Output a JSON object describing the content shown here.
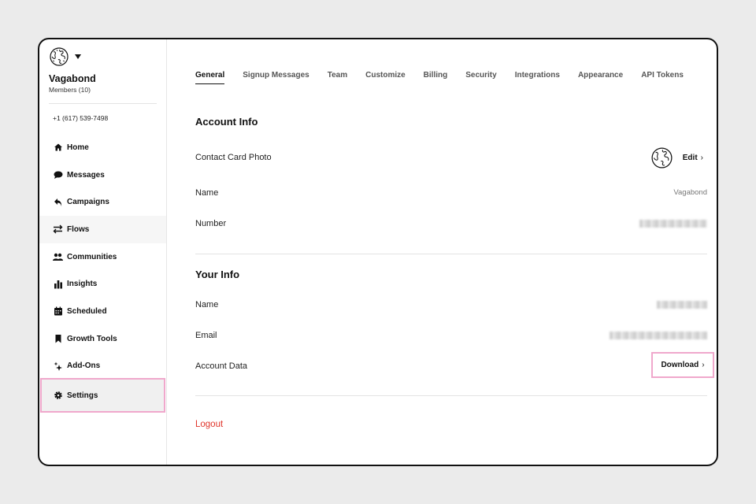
{
  "org": {
    "name": "Vagabond",
    "members": "Members (10)",
    "phone": "+1 (617) 539-7498"
  },
  "nav": [
    {
      "label": "Home",
      "icon": "home-icon"
    },
    {
      "label": "Messages",
      "icon": "chat-bubble-icon"
    },
    {
      "label": "Campaigns",
      "icon": "reply-arrow-icon"
    },
    {
      "label": "Flows",
      "icon": "swap-arrows-icon"
    },
    {
      "label": "Communities",
      "icon": "people-icon"
    },
    {
      "label": "Insights",
      "icon": "bar-chart-icon"
    },
    {
      "label": "Scheduled",
      "icon": "calendar-icon"
    },
    {
      "label": "Growth Tools",
      "icon": "bookmark-icon"
    },
    {
      "label": "Add-Ons",
      "icon": "sparkle-icon"
    },
    {
      "label": "Settings",
      "icon": "gear-icon"
    }
  ],
  "tabs": [
    "General",
    "Signup Messages",
    "Team",
    "Customize",
    "Billing",
    "Security",
    "Integrations",
    "Appearance",
    "API Tokens"
  ],
  "account_info": {
    "title": "Account Info",
    "contact_card_label": "Contact Card Photo",
    "edit_label": "Edit",
    "name_label": "Name",
    "name_value": "Vagabond",
    "number_label": "Number"
  },
  "your_info": {
    "title": "Your Info",
    "name_label": "Name",
    "email_label": "Email",
    "account_data_label": "Account Data",
    "download_label": "Download"
  },
  "logout_label": "Logout",
  "colors": {
    "highlight": "#f0a8cc",
    "logout": "#e0352b"
  }
}
